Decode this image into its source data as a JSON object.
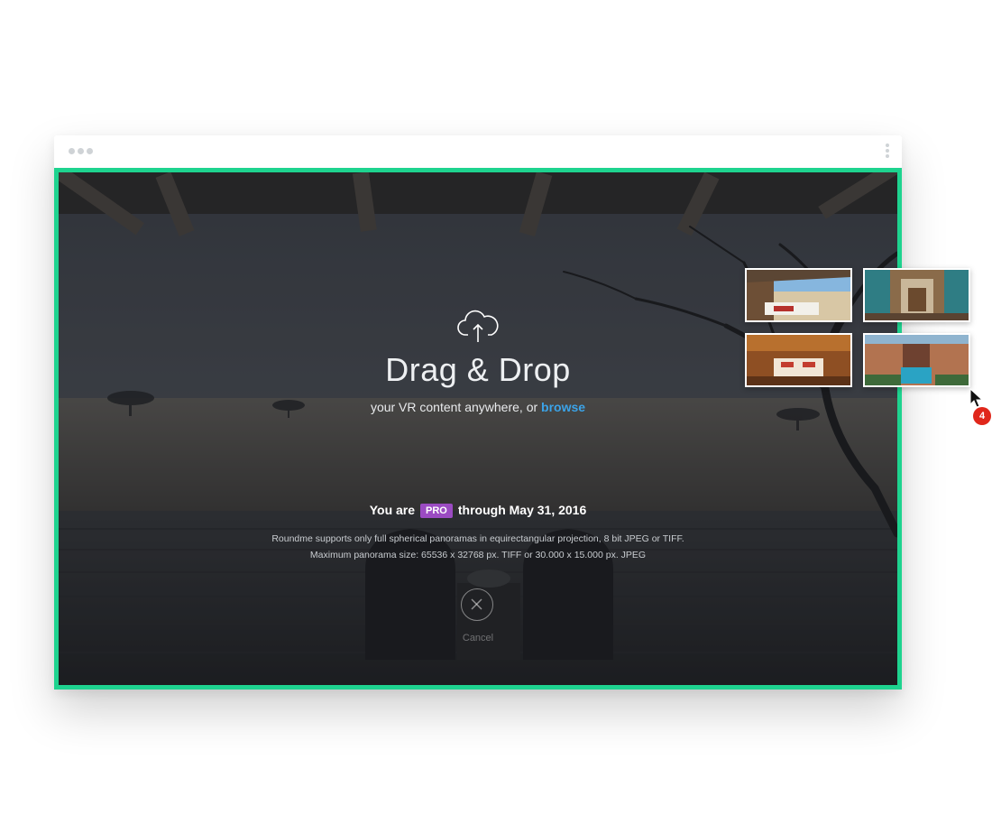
{
  "dropzone": {
    "title": "Drag & Drop",
    "subtitle_prefix": "your VR content anywhere, or",
    "browse_link": "browse",
    "status_prefix": "You are",
    "plan_badge": "PRO",
    "status_suffix": "through May 31, 2016",
    "info_line_1": "Roundme supports only full spherical panoramas in equirectangular projection, 8 bit JPEG or TIFF.",
    "info_line_2": "Maximum panorama size: 65536 x 32768 px. TIFF or 30.000 x 15.000 px. JPEG",
    "cancel_label": "Cancel",
    "cloud_icon": "cloud-upload-icon",
    "cancel_icon": "close-circle-icon"
  },
  "drag": {
    "file_count": "4",
    "thumbnails": [
      "desert-terrace-panorama",
      "courtyard-doorway-panorama",
      "lodge-bedroom-panorama",
      "pool-courtyard-panorama"
    ]
  },
  "colors": {
    "border_accent": "#1ed38f",
    "pro_badge": "#9b4bc2",
    "link": "#3ba3e8",
    "count_badge": "#e0271b"
  }
}
